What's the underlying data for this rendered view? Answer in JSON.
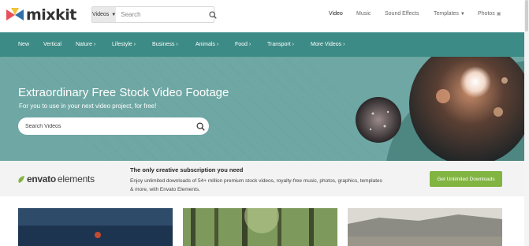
{
  "header": {
    "logo_text": "mixkit",
    "search": {
      "type_label": "Videos",
      "placeholder": "Search"
    },
    "nav": [
      "Video",
      "Music",
      "Sound Effects",
      "Templates",
      "Photos"
    ]
  },
  "categories": [
    "New",
    "Vertical",
    "Nature",
    "Lifestyle",
    "Business",
    "Animals",
    "Food",
    "Transport",
    "More Videos"
  ],
  "hero": {
    "title": "Extraordinary Free Stock Video Footage",
    "subtitle": "For you to use in your next video project, for free!",
    "search_placeholder": "Search Videos"
  },
  "envato": {
    "logo_envato": "envato",
    "logo_elements": "elements",
    "heading": "The only creative subscription you need",
    "body": "Enjoy unlimited downloads of 54+ million premium stock videos, royalty-free music, photos, graphics, templates & more, with Envato Elements.",
    "cta": "Get Unlimited Downloads"
  },
  "colors": {
    "nav_teal": "#3c8b86",
    "hero_teal": "#6ea7a3",
    "cta_green": "#81b441"
  },
  "icons": [
    "search-icon",
    "chevron-down-icon",
    "chevron-right-icon",
    "photo-icon",
    "envato-leaf-icon"
  ]
}
